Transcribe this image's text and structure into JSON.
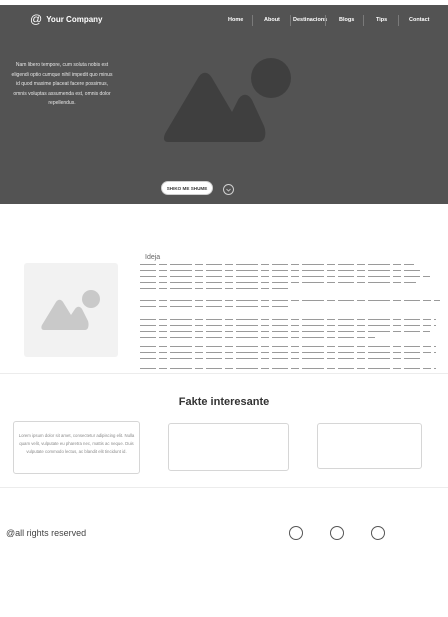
{
  "brand": {
    "symbol": "@",
    "name": "Your Company"
  },
  "nav": {
    "items": [
      "Home",
      "About",
      "Destinacions",
      "Blogs",
      "Tips",
      "Contact"
    ]
  },
  "hero": {
    "text": "Nam libero tempore, cum soluta nobis est eligendi optio cumque nihil impedit quo minus id quod maxime placeat facere possimus, omnis voluptas assumenda est, omnis dolor repellendus.",
    "cta_label": "SHIKO ME SHUME",
    "image_icon": "image-placeholder-icon",
    "scroll_icon": "chevron-down-icon",
    "background": "#535353"
  },
  "about": {
    "heading": "Ideja",
    "image_icon": "image-placeholder-icon"
  },
  "facts": {
    "title": "Fakte interesante",
    "cards": [
      {
        "text": "Lorem ipsum dolor sit amet, consectetur adipiscing elit. Nulla quam velit, vulputate eu pharetra nec, mattis ac neque. Duis vulputate commodo lectus, ac blandit elit tincidunt id."
      },
      {
        "text": ""
      },
      {
        "text": ""
      }
    ]
  },
  "footer": {
    "copyright": "@all rights reserved",
    "social_icons": [
      "social-icon",
      "social-icon",
      "social-icon"
    ]
  }
}
